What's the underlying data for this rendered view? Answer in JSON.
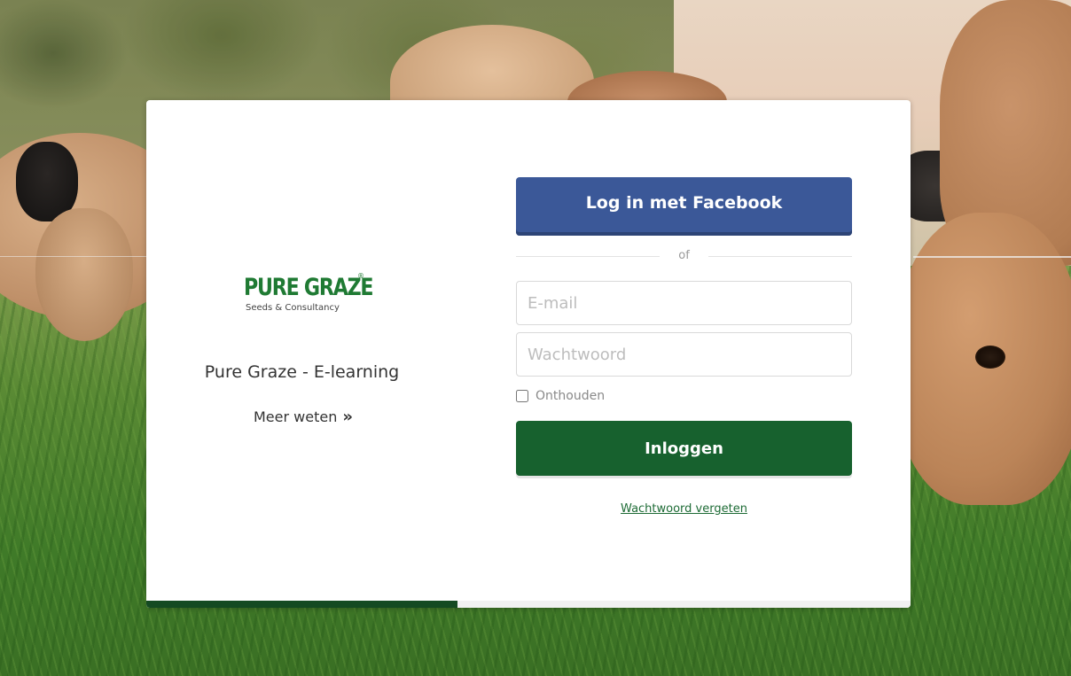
{
  "brand": {
    "logo_text": "PURE GRAZE",
    "logo_registered": "®",
    "logo_tagline": "Seeds & Consultancy",
    "site_title": "Pure Graze - E-learning",
    "more_link": "Meer weten",
    "more_chevron": "»",
    "logo_color": "#1f7a33"
  },
  "login": {
    "facebook_button": "Log in met Facebook",
    "divider_text": "of",
    "email_placeholder": "E-mail",
    "password_placeholder": "Wachtwoord",
    "remember_label": "Onthouden",
    "remember_checked": false,
    "submit_button": "Inloggen",
    "forgot_link": "Wachtwoord vergeten",
    "facebook_color": "#3b5898",
    "submit_color": "#17612e"
  },
  "progress": {
    "fraction": 0.407,
    "color": "#144a22"
  }
}
